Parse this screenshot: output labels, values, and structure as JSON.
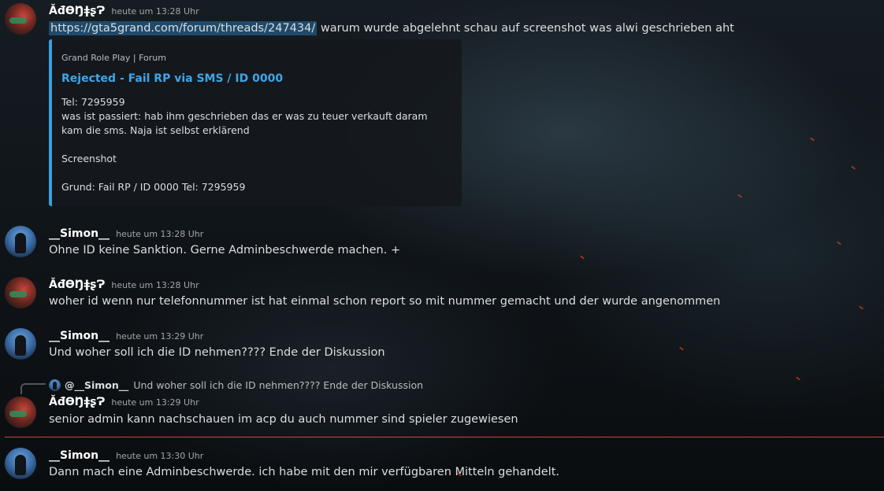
{
  "messages": [
    {
      "author": "ĂđϴŊǂʂɁ",
      "timestamp": "heute um 13:28 Uhr",
      "link": "https://gta5grand.com/forum/threads/247434/",
      "text": " warum wurde abgelehnt schau auf screenshot was alwi geschrieben aht",
      "embed": {
        "provider": "Grand Role Play | Forum",
        "title": "Rejected - Fail RP via SMS / ID 0000",
        "lines": [
          "Tel: 7295959",
          "was ist passiert: hab ihm geschrieben das er was zu teuer verkauft daram",
          "kam die sms. Naja ist selbst erklärend",
          "Screenshot",
          "Grund: Fail RP / ID 0000 Tel: 7295959"
        ]
      }
    },
    {
      "author": "__Simon__",
      "timestamp": "heute um 13:28 Uhr",
      "text": "Ohne ID keine Sanktion. Gerne Adminbeschwerde machen. +"
    },
    {
      "author": "ĂđϴŊǂʂɁ",
      "timestamp": "heute um 13:28 Uhr",
      "text": "woher id wenn nur telefonnummer ist hat einmal schon report so mit nummer gemacht und der wurde angenommen"
    },
    {
      "author": "__Simon__",
      "timestamp": "heute um 13:29 Uhr",
      "text": "Und woher soll ich die ID nehmen???? Ende der Diskussion"
    },
    {
      "reply": {
        "author": "@__Simon__",
        "text": "Und woher soll ich die ID nehmen???? Ende der Diskussion"
      },
      "author": "ĂđϴŊǂʂɁ",
      "timestamp": "heute um 13:29 Uhr",
      "text": "senior admin kann nachschauen im acp du auch nummer sind spieler zugewiesen"
    },
    {
      "author": "__Simon__",
      "timestamp": "heute um 13:30 Uhr",
      "text": "Dann mach eine Adminbeschwerde. ich habe mit den mir verfügbaren Mitteln gehandelt."
    }
  ],
  "colors": {
    "link_highlight": "#1f4a6b",
    "embed_accent": "#3aa0e0",
    "embed_title": "#3ea6e8",
    "new_messages_divider": "#d8453c"
  },
  "icons": {
    "avatar_1": "red-avatar",
    "avatar_2": "darth-vader-avatar"
  }
}
